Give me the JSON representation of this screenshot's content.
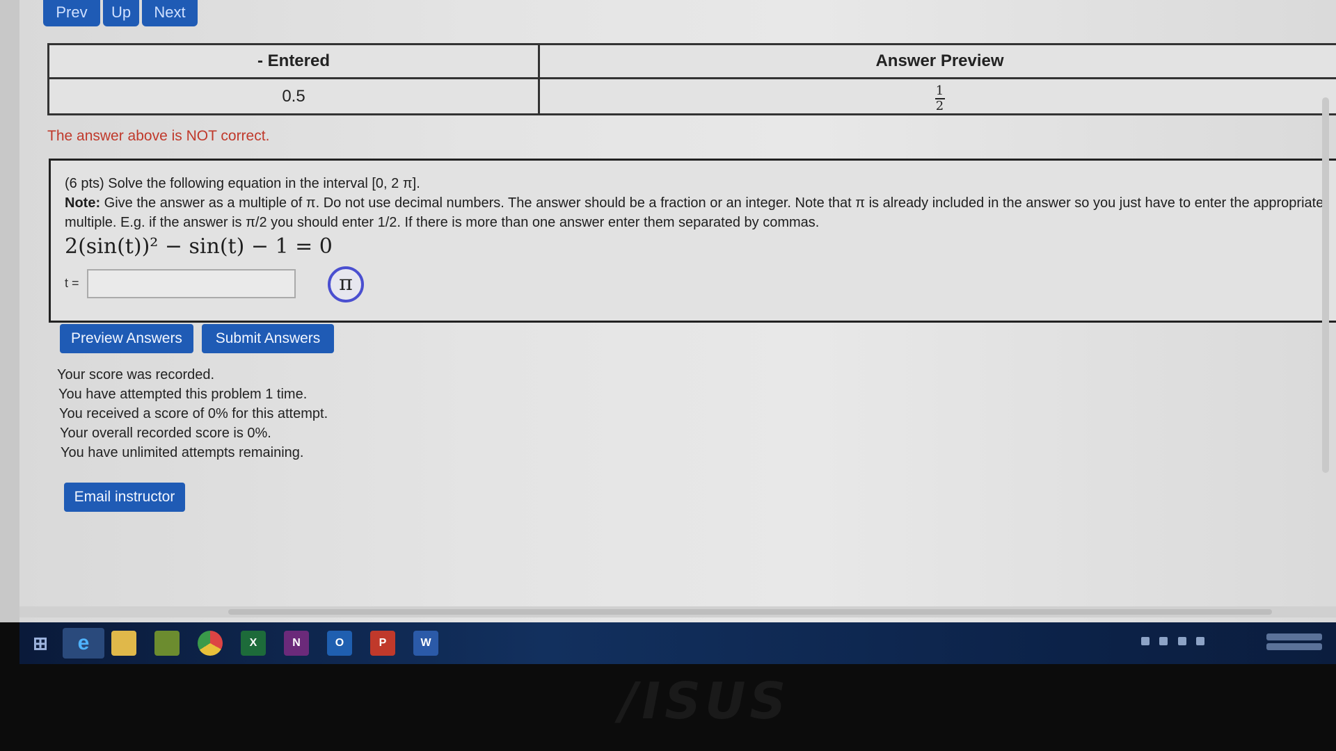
{
  "nav": {
    "prev": "Prev",
    "up": "Up",
    "next": "Next"
  },
  "answer_table": {
    "headers": [
      "- Entered",
      "Answer Preview"
    ],
    "entered": "0.5",
    "preview_numerator": "1",
    "preview_denominator": "2"
  },
  "result_message": "The answer above is NOT correct.",
  "problem": {
    "line1": "(6 pts) Solve the following equation in the interval [0, 2 π].",
    "note_label": "Note:",
    "line2": "Give the answer as a multiple of π. Do not use decimal numbers. The answer should be a fraction or an integer. Note that π is already included in the answer so you just have to enter the appropriate",
    "line3": "multiple. E.g. if the answer is π/2 you should enter 1/2. If there is more than one answer enter them separated by commas.",
    "equation": "2(sin(t))² − sin(t) − 1 = 0",
    "answer_label": "t =",
    "answer_value": "",
    "pi_button": "π"
  },
  "buttons": {
    "preview": "Preview Answers",
    "submit": "Submit Answers",
    "email": "Email instructor"
  },
  "status": [
    "Your score was recorded.",
    "You have attempted this problem 1 time.",
    "You received a score of 0% for this attempt.",
    "Your overall recorded score is 0%.",
    "You have unlimited attempts remaining."
  ],
  "taskbar": {
    "icons": [
      "windows-start-icon",
      "internet-explorer-icon",
      "file-explorer-icon",
      "store-icon",
      "chrome-icon",
      "excel-icon",
      "onenote-icon",
      "outlook-icon",
      "powerpoint-icon",
      "word-icon"
    ],
    "labels": {
      "excel": "X",
      "onenote": "N",
      "outlook": "O",
      "powerpoint": "P",
      "word": "W"
    }
  },
  "bezel_logo": "/ISUS",
  "colors": {
    "button_blue": "#1f5bb5",
    "error_red": "#c0392b",
    "taskbar": "#12305e"
  }
}
